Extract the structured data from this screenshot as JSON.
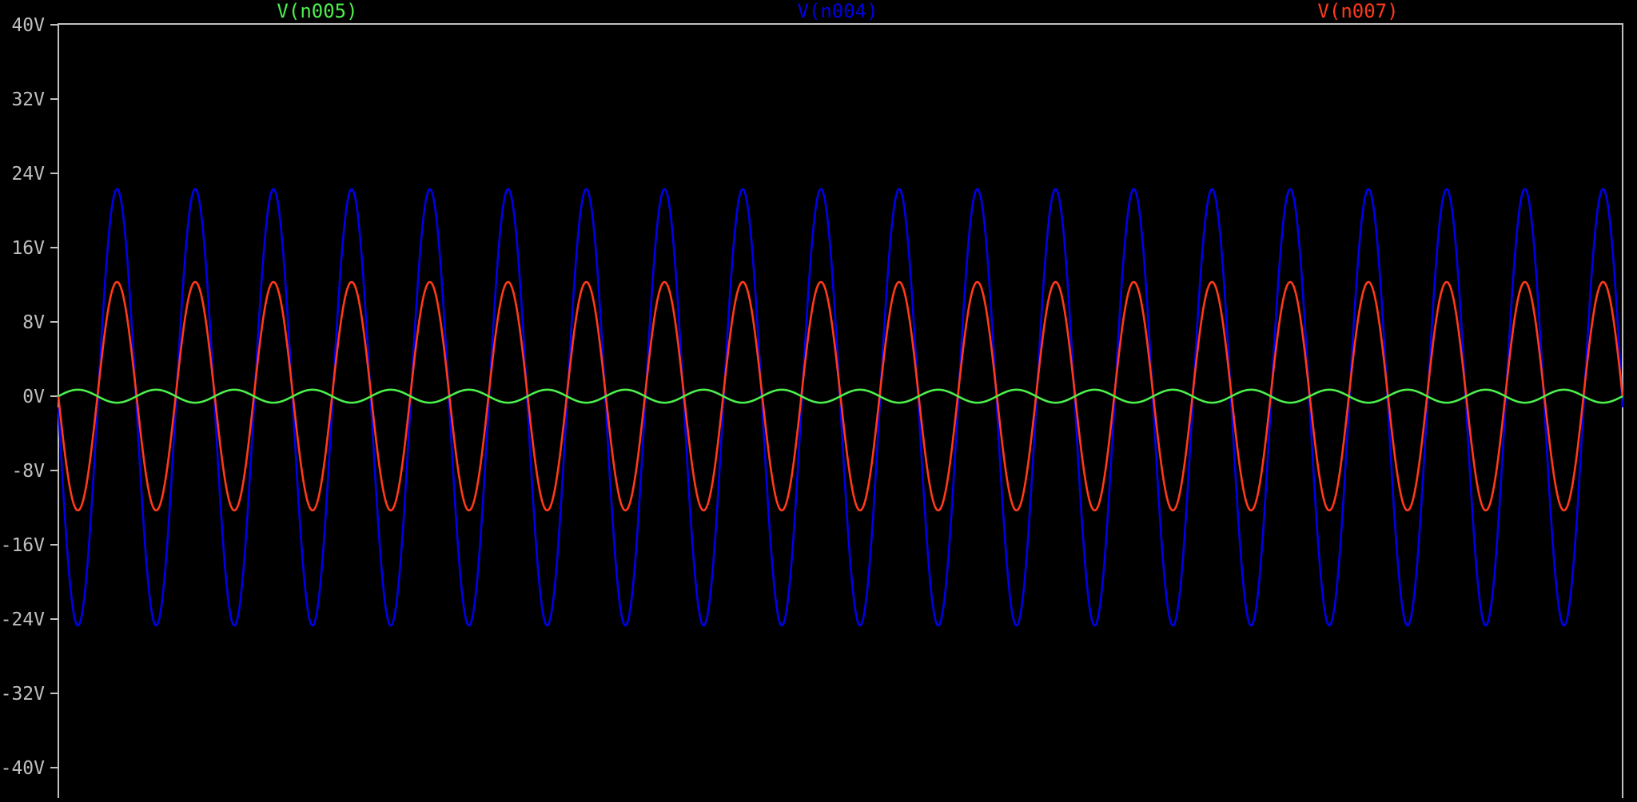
{
  "window": {
    "background": "#000000",
    "frame_color": "#c0c0c0",
    "tick_label_color": "#c0c0c0"
  },
  "chart_data": {
    "type": "line",
    "title": "",
    "xlabel": "",
    "ylabel": "",
    "ylim": [
      -40,
      40
    ],
    "y_ticks": [
      40,
      32,
      24,
      16,
      8,
      0,
      -8,
      -16,
      -24,
      -32,
      -40
    ],
    "y_tick_labels": [
      "40V",
      "32V",
      "24V",
      "16V",
      "8V",
      "0V",
      "-8V",
      "-16V",
      "-24V",
      "-32V",
      "-40V"
    ],
    "grid": false,
    "legend_placement": "top",
    "cycles": 20,
    "series": [
      {
        "name": "V(n005)",
        "color": "#4cf04c",
        "waveform": "sine",
        "amplitude": 0.7,
        "offset": 0,
        "phase_deg": 0
      },
      {
        "name": "V(n004)",
        "color": "#0000e6",
        "waveform": "sine",
        "amplitude": 23.5,
        "offset": -1.2,
        "phase_deg": 180
      },
      {
        "name": "V(n007)",
        "color": "#ff3a1a",
        "waveform": "sine",
        "amplitude": 12.3,
        "offset": 0,
        "phase_deg": 180
      }
    ]
  }
}
